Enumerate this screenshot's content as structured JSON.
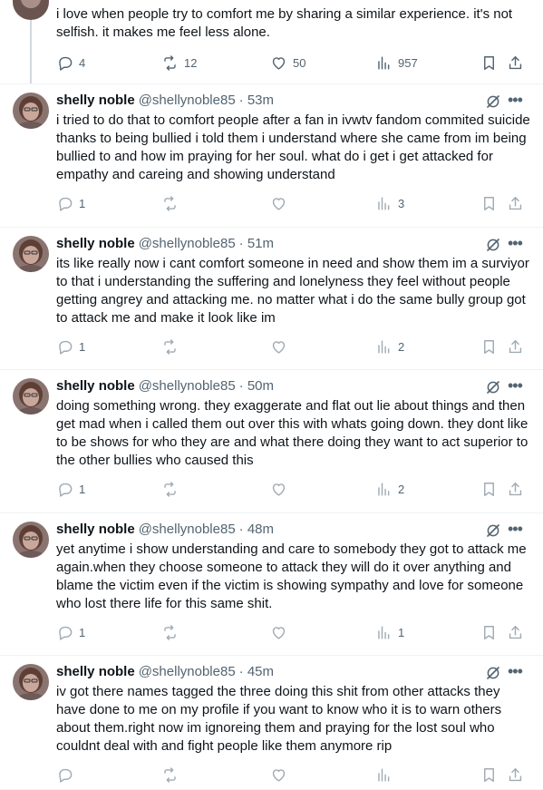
{
  "previous_tweet": {
    "text": "i love when people try to comfort me by sharing a similar experience. it's not selfish. it makes me feel less alone.",
    "replies": "4",
    "reposts": "12",
    "likes": "50",
    "views": "957"
  },
  "tweets": [
    {
      "name": "shelly noble",
      "handle": "@shellynoble85",
      "time": "· 53m",
      "text": "i tried to do that to comfort people after a fan in ivwtv fandom commited suicide thanks to being bullied i told them i understand where she came from im being bullied to and how im praying for her soul. what do i get i get attacked for empathy and careing and showing understand",
      "replies": "1",
      "views": "3"
    },
    {
      "name": "shelly noble",
      "handle": "@shellynoble85",
      "time": "· 51m",
      "text": "its like really now i cant comfort someone in need and show them im a surviyor to that i understanding the suffering and lonelyness they feel without people getting angrey and attacking me. no matter what i do the same bully group got to attack me and make it look like im",
      "replies": "1",
      "views": "2"
    },
    {
      "name": "shelly noble",
      "handle": "@shellynoble85",
      "time": "· 50m",
      "text": "doing something wrong. they exaggerate and flat out lie about things and then get mad when i called them out over this with whats going down. they dont like to be shows for who they are and what there doing they want to act superior to the other bullies who caused this",
      "replies": "1",
      "views": "2"
    },
    {
      "name": "shelly noble",
      "handle": "@shellynoble85",
      "time": "· 48m",
      "text": "yet anytime i show understanding and care to somebody they got to attack me again.when they choose someone to attack they will do it over anything and blame the victim even if the victim is showing sympathy and love for someone who lost there life for this same shit.",
      "replies": "1",
      "views": "1"
    },
    {
      "name": "shelly noble",
      "handle": "@shellynoble85",
      "time": "· 45m",
      "text": "iv got there names tagged the three doing this shit from other attacks they have done to me on my profile if you want to know who it is to warn others about them.right now im ignoreing them and praying for the lost soul who couldnt deal with and fight people like them anymore rip",
      "replies": "",
      "views": ""
    }
  ],
  "icons": {
    "reply": "reply-icon",
    "repost": "repost-icon",
    "like": "heart-icon",
    "views": "views-icon",
    "bookmark": "bookmark-icon",
    "share": "share-icon",
    "grok": "grok-icon",
    "more": "more-icon"
  },
  "colors": {
    "text": "#0f1419",
    "secondary": "#536471",
    "divider": "#eff3f4"
  }
}
